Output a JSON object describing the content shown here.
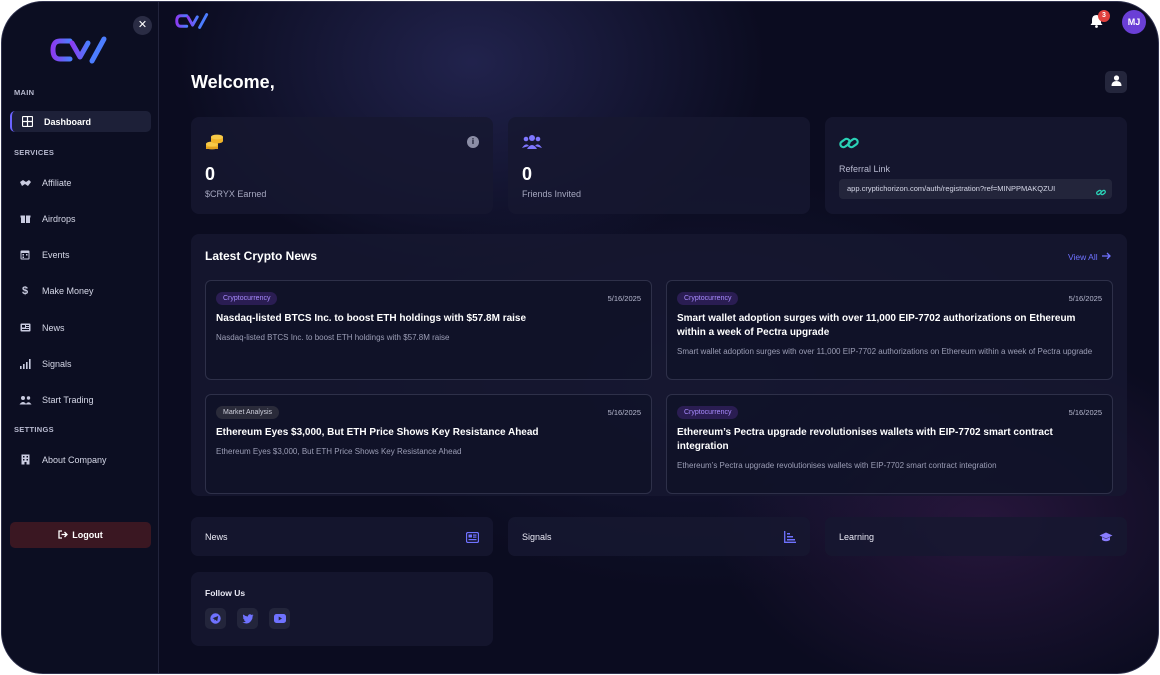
{
  "sidebar": {
    "sections": {
      "main": "MAIN",
      "services": "SERVICES",
      "settings": "SETTINGS"
    },
    "items": [
      {
        "label": "Dashboard",
        "icon": "grid-icon",
        "active": true
      },
      {
        "label": "Affiliate",
        "icon": "handshake-icon"
      },
      {
        "label": "Airdrops",
        "icon": "gift-icon"
      },
      {
        "label": "Events",
        "icon": "calendar-icon"
      },
      {
        "label": "Make Money",
        "icon": "dollar-icon"
      },
      {
        "label": "News",
        "icon": "newspaper-icon"
      },
      {
        "label": "Signals",
        "icon": "signal-bars-icon"
      },
      {
        "label": "Start Trading",
        "icon": "users-icon"
      },
      {
        "label": "About Company",
        "icon": "building-icon"
      }
    ],
    "logout_label": "Logout"
  },
  "header": {
    "notification_count": "3",
    "avatar_initials": "MJ"
  },
  "welcome": "Welcome,",
  "stats": {
    "earned": {
      "value": "0",
      "label": "$CRYX Earned"
    },
    "friends": {
      "value": "0",
      "label": "Friends Invited"
    },
    "referral": {
      "label": "Referral Link",
      "link": "app.cryptichorizon.com/auth/registration?ref=MINPPMAKQZUI"
    }
  },
  "news": {
    "title": "Latest Crypto News",
    "view_all": "View All",
    "items": [
      {
        "tag": "Cryptocurrency",
        "date": "5/16/2025",
        "headline": "Nasdaq-listed BTCS Inc. to boost ETH holdings with $57.8M raise",
        "desc": "Nasdaq-listed BTCS Inc. to boost ETH holdings with $57.8M raise"
      },
      {
        "tag": "Cryptocurrency",
        "date": "5/16/2025",
        "headline": "Smart wallet adoption surges with over 11,000 EIP-7702 authorizations on Ethereum within a week of Pectra upgrade",
        "desc": "Smart wallet adoption surges with over 11,000 EIP-7702 authorizations on Ethereum within a week of Pectra upgrade"
      },
      {
        "tag": "Market Analysis",
        "date": "5/16/2025",
        "headline": "Ethereum Eyes $3,000, But ETH Price Shows Key Resistance Ahead",
        "desc": "Ethereum Eyes $3,000, But ETH Price Shows Key Resistance Ahead"
      },
      {
        "tag": "Cryptocurrency",
        "date": "5/16/2025",
        "headline": "Ethereum’s Pectra upgrade revolutionises wallets with EIP-7702 smart contract integration",
        "desc": "Ethereum’s Pectra upgrade revolutionises wallets with EIP-7702 smart contract integration"
      }
    ]
  },
  "quick_links": [
    {
      "label": "News",
      "icon": "newspaper-icon"
    },
    {
      "label": "Signals",
      "icon": "bar-chart-icon"
    },
    {
      "label": "Learning",
      "icon": "graduation-cap-icon"
    }
  ],
  "follow": {
    "title": "Follow Us",
    "icons": [
      "telegram-icon",
      "twitter-icon",
      "youtube-icon"
    ]
  },
  "colors": {
    "accent": "#6b63ff",
    "gold": "#f0b429",
    "teal": "#2ad1b6",
    "badge": "#e0413e",
    "avatar": "#6a3fd6"
  }
}
